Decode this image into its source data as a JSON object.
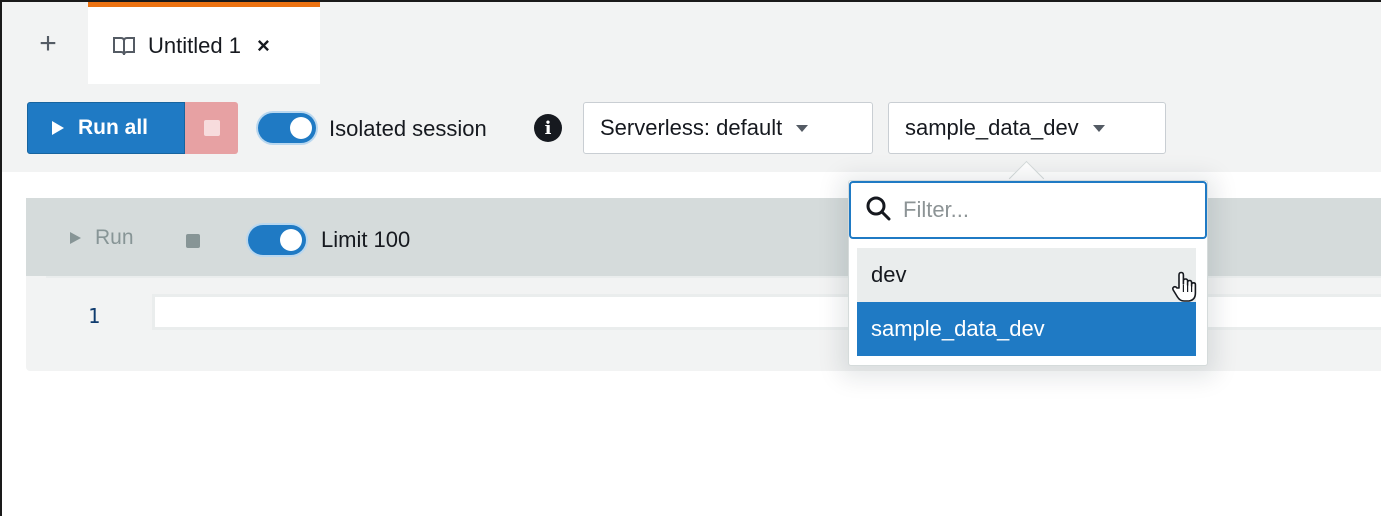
{
  "tabs": {
    "add_label": "+",
    "active": {
      "title": "Untitled 1",
      "close": "×"
    }
  },
  "toolbar": {
    "run_all": "Run all",
    "isolated_session": "Isolated session",
    "info_glyph": "i",
    "isolated_enabled": true,
    "workgroup_select": "Serverless: default",
    "database_select": "sample_data_dev"
  },
  "cell": {
    "run": "Run",
    "limit_label": "Limit 100",
    "limit_enabled": true,
    "line_number": "1"
  },
  "database_dropdown": {
    "filter_placeholder": "Filter...",
    "filter_value": "",
    "options": [
      {
        "label": "dev",
        "state": "hover"
      },
      {
        "label": "sample_data_dev",
        "state": "selected"
      }
    ]
  },
  "colors": {
    "accent": "#1f7ac4",
    "tab_indicator": "#ec7211",
    "stop_disabled": "#e7a1a3"
  },
  "icons": [
    "plus-icon",
    "notebook-icon",
    "close-icon",
    "play-icon",
    "stop-icon",
    "info-icon",
    "caret-down-icon",
    "search-icon",
    "pointer-hand-icon"
  ]
}
